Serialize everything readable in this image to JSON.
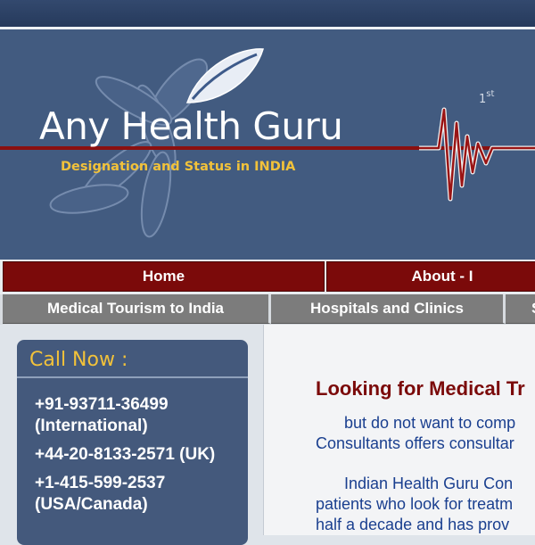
{
  "site": {
    "title": "Any Health Guru",
    "tagline": "Designation and Status in INDIA",
    "banner_mark": "1",
    "banner_mark_sup": "st"
  },
  "nav_primary": [
    {
      "label": "Home"
    },
    {
      "label": "About - I"
    }
  ],
  "nav_secondary": [
    {
      "label": "Medical Tourism to India"
    },
    {
      "label": "Hospitals and Clinics"
    },
    {
      "label": "S"
    }
  ],
  "sidebar": {
    "call_heading": "Call Now :",
    "phones": [
      {
        "text": "+91-93711-36499 (International)"
      },
      {
        "text": "+44-20-8133-2571 (UK)"
      },
      {
        "text": "+1-415-599-2537 (USA/Canada)"
      }
    ]
  },
  "main": {
    "heading": "Looking for Medical Tr",
    "para1": [
      "but do not want to comp",
      "Consultants offers consultar"
    ],
    "para2": [
      "Indian Health Guru Con",
      "patients who look for treatm",
      "half a decade and has prov"
    ]
  },
  "colors": {
    "topbar": "#2c4166",
    "banner": "#425b80",
    "nav_primary": "#7b0a0a",
    "nav_secondary": "#7c7c7c",
    "accent_yellow": "#f2c23a",
    "heading_red": "#7b0a0a",
    "body_blue": "#1a3f8f"
  }
}
